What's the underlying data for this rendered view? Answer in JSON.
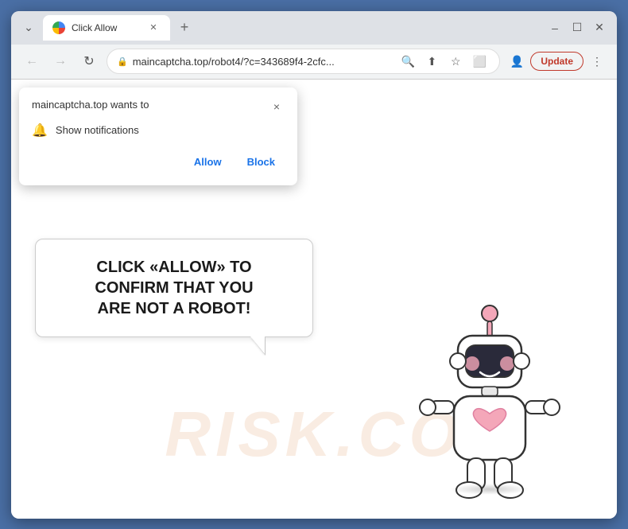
{
  "browser": {
    "tab": {
      "title": "Click Allow",
      "favicon_label": "chrome-favicon"
    },
    "window_controls": {
      "minimize": "–",
      "maximize": "☐",
      "close": "✕",
      "chevron": "⌄"
    },
    "nav": {
      "back": "←",
      "forward": "→",
      "reload": "↻"
    },
    "url": {
      "lock": "🔒",
      "full": "maincaptcha.top/robot4/?c=343689f4-2cfc...",
      "search_icon": "🔍",
      "share_icon": "⬆",
      "star_icon": "☆",
      "tab_icon": "⬜",
      "profile_icon": "👤"
    },
    "update_button": "Update",
    "more_icon": "⋮"
  },
  "notification_popup": {
    "title": "maincaptcha.top wants to",
    "close": "×",
    "notification_item": "Show notifications",
    "allow_label": "Allow",
    "block_label": "Block"
  },
  "page": {
    "bubble_text_line1": "CLICK «ALLOW» TO CONFIRM THAT YOU",
    "bubble_text_line2": "ARE NOT A ROBOT!",
    "watermark": "RISK.CO"
  }
}
